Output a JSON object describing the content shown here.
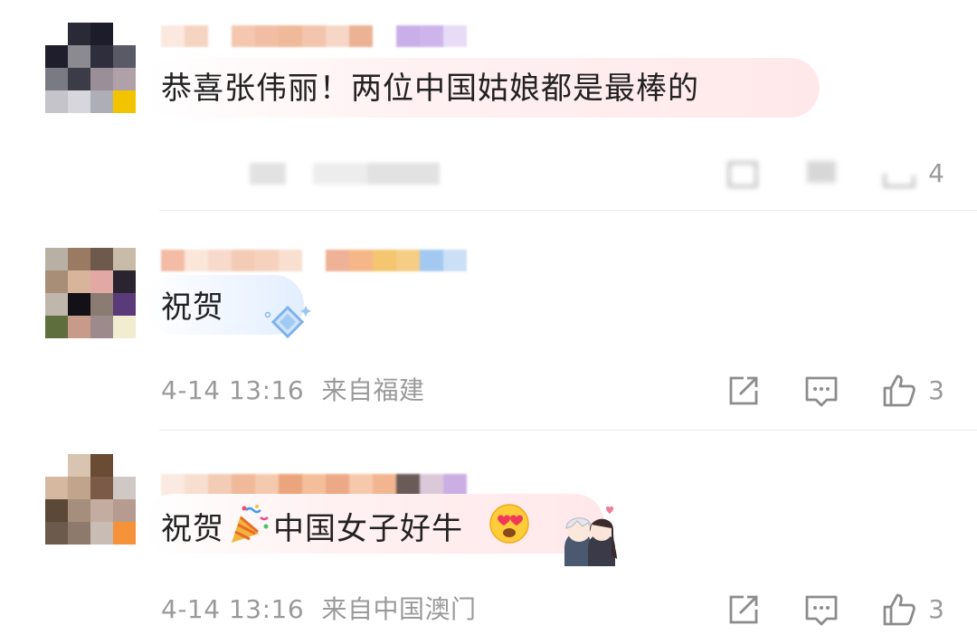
{
  "comments": [
    {
      "text": "恭喜张伟丽！两位中国姑娘都是最棒的",
      "time": "",
      "location": "",
      "likes": "4"
    },
    {
      "text": "祝贺",
      "time": "4-14 13:16",
      "location": "来自福建",
      "likes": "3"
    },
    {
      "text_before": "祝贺",
      "text_after": "中国女子好牛",
      "time": "4-14 13:16",
      "location": "来自中国澳门",
      "likes": "3"
    }
  ],
  "icons": {
    "share": "share-icon",
    "reply": "comment-icon",
    "like": "thumbs-up-icon",
    "party": "party-popper-icon",
    "heart_eyes": "heart-eyes-icon",
    "sticker": "couple-sticker-icon",
    "badge": "diamond-badge-icon"
  },
  "colors": {
    "text": "#222222",
    "meta": "#9a9a9a",
    "divider": "#eaeaea"
  }
}
